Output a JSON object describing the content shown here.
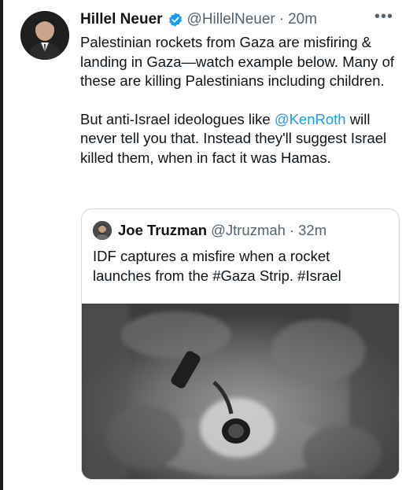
{
  "tweet": {
    "author_name": "Hillel Neuer",
    "author_handle": "@HillelNeuer",
    "separator": "·",
    "timestamp": "20m",
    "more_label": "•••",
    "paragraph1": "Palestinian rockets from Gaza are misfiring & landing in Gaza—watch example below. Many of these are killing Palestinians including children.",
    "paragraph2_before": "But anti-Israel ideologues like ",
    "mention": "@KenRoth",
    "paragraph2_after": " will never tell you that. Instead they'll suggest Israel killed them, when in fact it was Hamas."
  },
  "quoted_tweet": {
    "author_name": "Joe Truzman",
    "author_handle": "@Jtruzmah",
    "separator": "·",
    "timestamp": "32m",
    "text": "IDF captures a misfire when a rocket launches from the #Gaza Strip. #Israel"
  },
  "colors": {
    "accent": "#1d9bf0",
    "secondary_text": "#536471",
    "border": "#cfd9de"
  },
  "icons": {
    "verified": "verified-badge-icon",
    "more": "more-options-icon"
  }
}
